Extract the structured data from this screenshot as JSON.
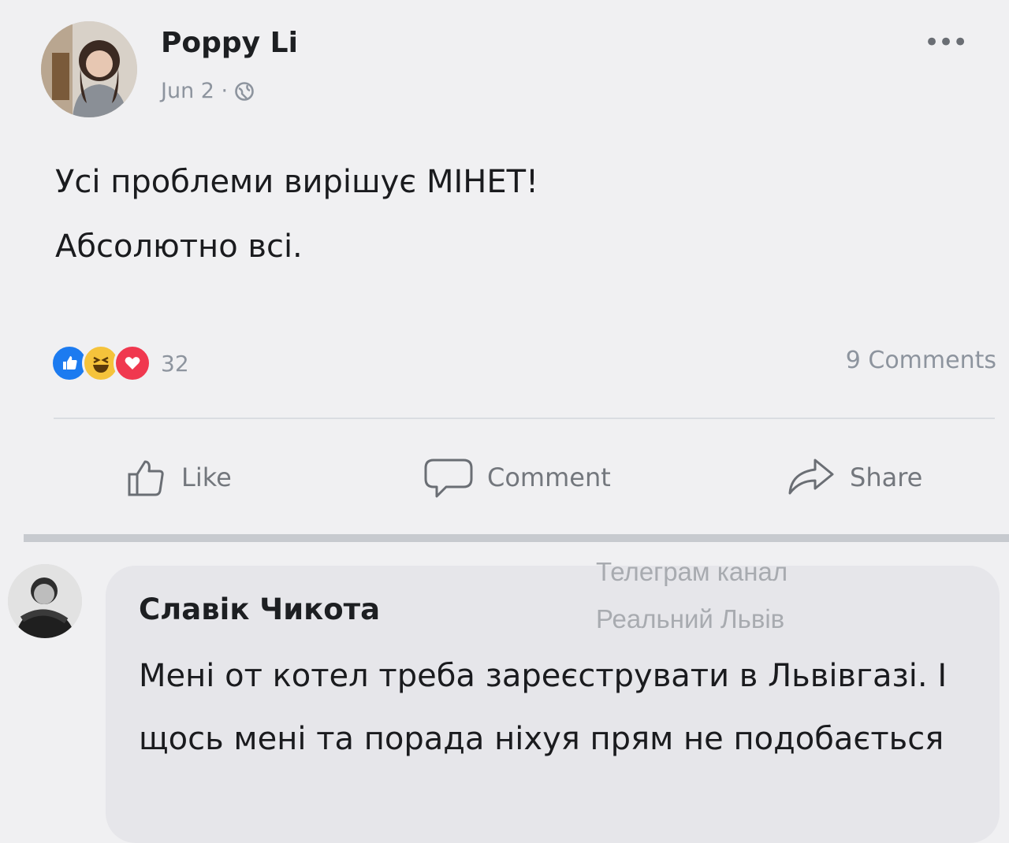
{
  "post": {
    "author": "Poppy Li",
    "date": "Jun 2 ·",
    "privacy_icon": "globe-icon",
    "more_icon": "•••",
    "text_lines": [
      "Усі проблеми вирішує МІНЕТ!",
      "Абсолютно всі."
    ],
    "reactions": [
      "like-reaction-icon",
      "haha-reaction-icon",
      "love-reaction-icon"
    ],
    "reaction_count": "32",
    "comments_count": "9 Comments"
  },
  "actions": {
    "like": "Like",
    "comment": "Comment",
    "share": "Share"
  },
  "watermark": {
    "line1": "Телеграм канал",
    "line2": "Реальний Львів"
  },
  "comment": {
    "author": "Славік Чикота",
    "text": "Мені от котел треба зареєструвати в Львівгазі. І щось мені та порада ніхуя прям не подобається"
  },
  "colors": {
    "background": "#f0f0f2",
    "bubble": "#e6e6ea",
    "like": "#1c7bf0",
    "haha": "#f5c33b",
    "love": "#f0384f",
    "muted_text": "#8d949e"
  }
}
